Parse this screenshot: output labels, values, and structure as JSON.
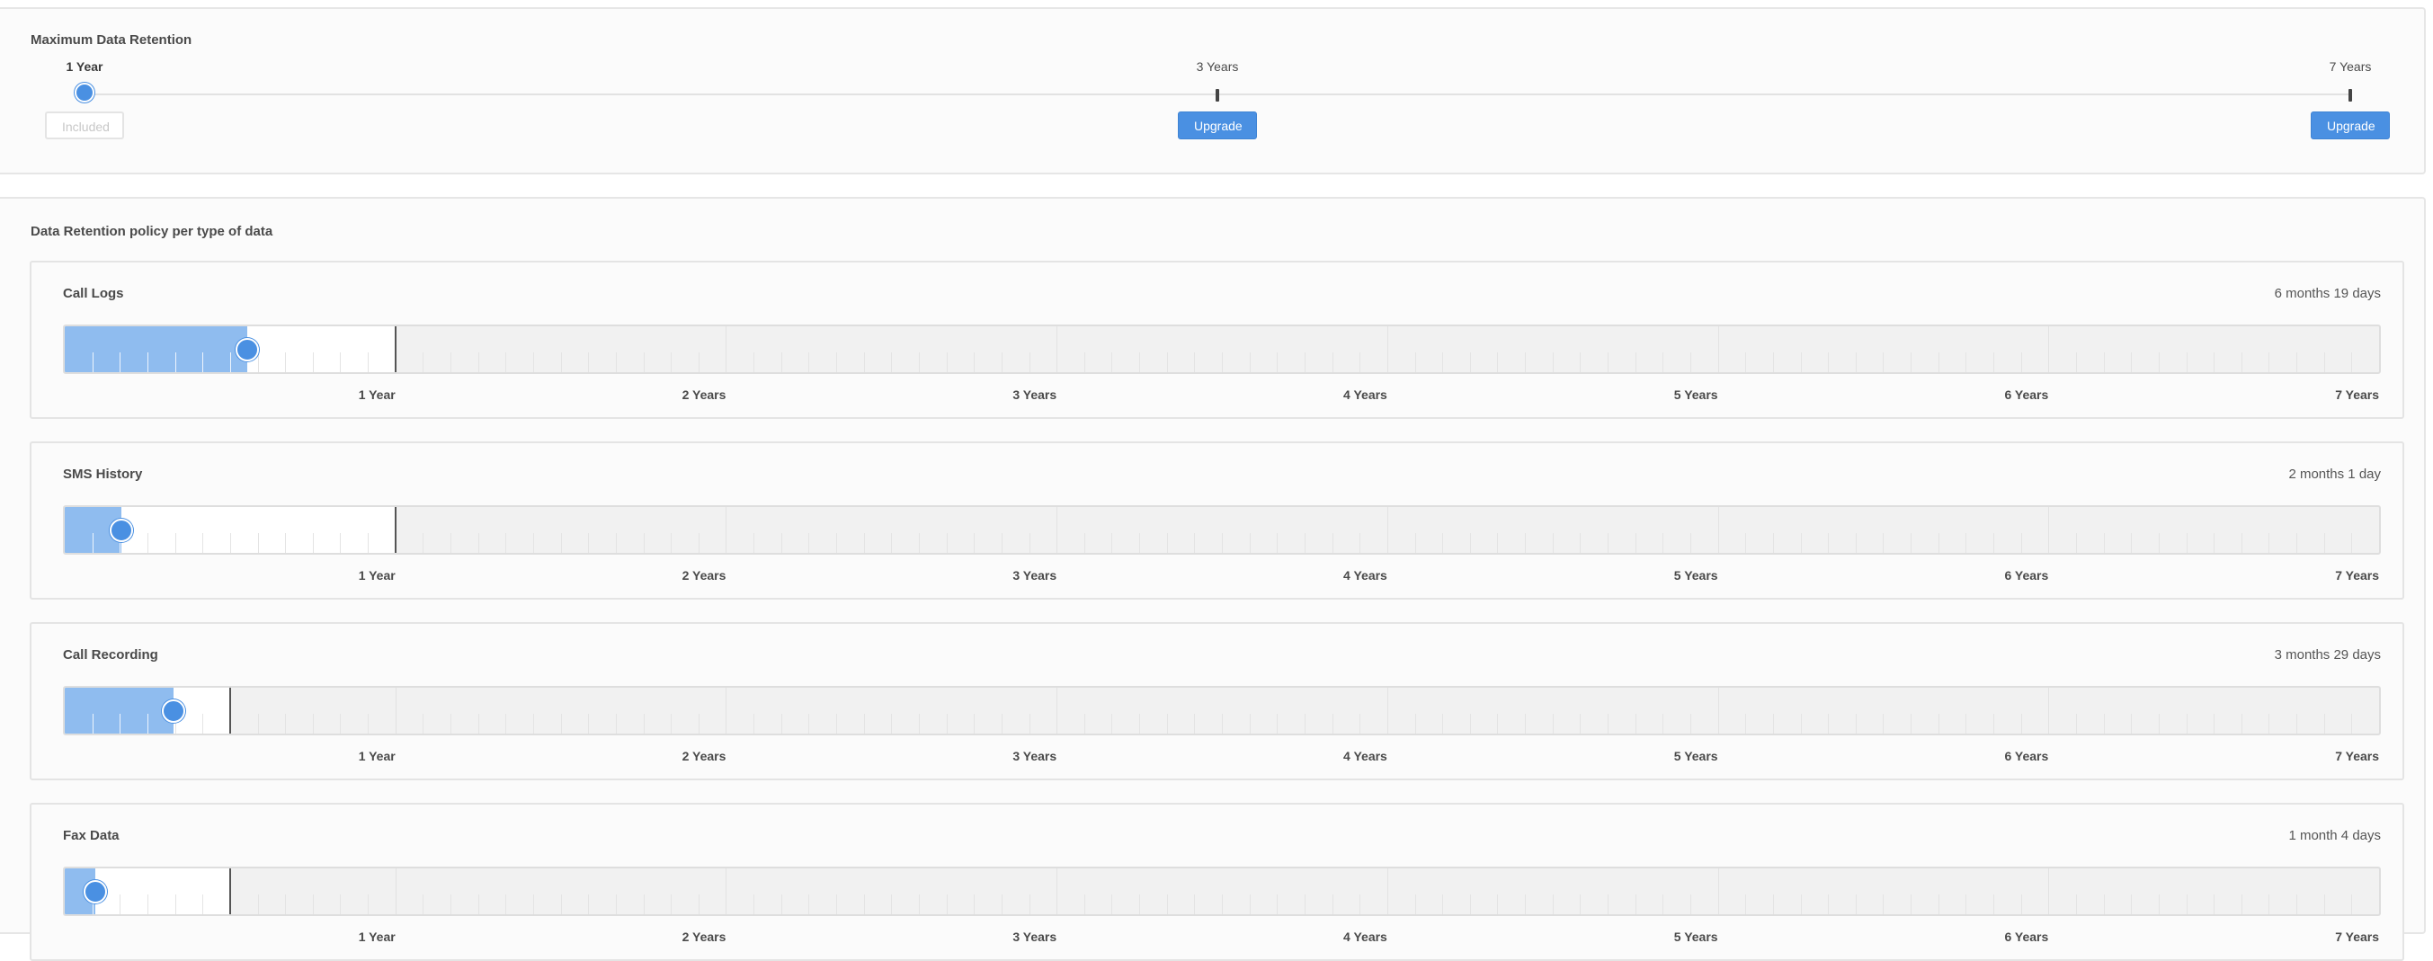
{
  "max_retention": {
    "title": "Maximum Data Retention",
    "stops": [
      {
        "label": "1 Year",
        "years": 1,
        "selected": true,
        "button": "Included"
      },
      {
        "label": "3 Years",
        "years": 3,
        "selected": false,
        "button": "Upgrade"
      },
      {
        "label": "7 Years",
        "years": 7,
        "selected": false,
        "button": "Upgrade"
      }
    ]
  },
  "policy": {
    "title": "Data Retention policy per type of data",
    "axis_labels": [
      "1 Year",
      "2 Years",
      "3 Years",
      "4 Years",
      "5 Years",
      "6 Years",
      "7 Years"
    ],
    "items": [
      {
        "name": "Call Logs",
        "value_text": "6 months 19 days",
        "value_years": 0.551,
        "limit_years": 1
      },
      {
        "name": "SMS History",
        "value_text": "2 months 1 day",
        "value_years": 0.17,
        "limit_years": 1
      },
      {
        "name": "Call Recording",
        "value_text": "3 months 29 days",
        "value_years": 0.328,
        "limit_years": 0.5
      },
      {
        "name": "Fax Data",
        "value_text": "1 month 4 days",
        "value_years": 0.093,
        "limit_years": 0.5
      }
    ]
  },
  "colors": {
    "accent": "#4a90e2",
    "fill": "#8fbcef",
    "track_locked": "#f1f1f1"
  }
}
